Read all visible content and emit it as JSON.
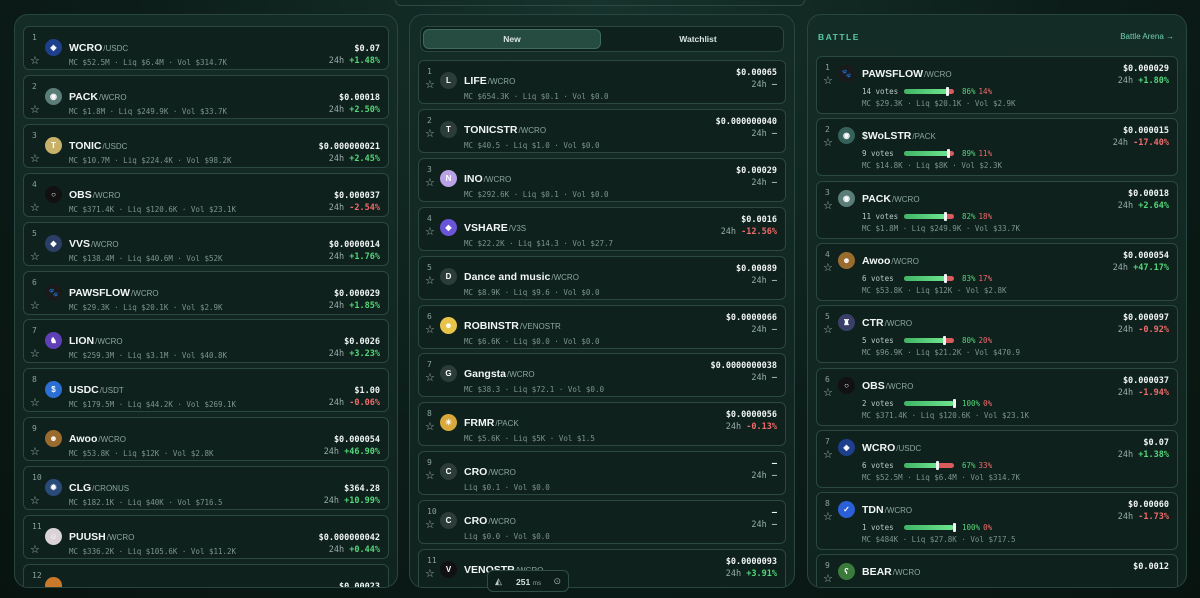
{
  "left": {
    "items": [
      {
        "rank": "1",
        "symbol": "WCRO",
        "pair": "/USDC",
        "price": "$0.07",
        "change": "+1.48%",
        "trend": "pos",
        "mc": "$52.5M",
        "liq": "$6.4M",
        "vol": "$314.7K",
        "logo_color": "#1d3f8c",
        "logo_text": "◈"
      },
      {
        "rank": "2",
        "symbol": "PACK",
        "pair": "/WCRO",
        "price": "$0.00018",
        "change": "+2.50%",
        "trend": "pos",
        "mc": "$1.8M",
        "liq": "$249.9K",
        "vol": "$33.7K",
        "logo_color": "#5b7d79",
        "logo_text": "◉"
      },
      {
        "rank": "3",
        "symbol": "TONIC",
        "pair": "/USDC",
        "price": "$0.000000021",
        "change": "+2.45%",
        "trend": "pos",
        "mc": "$10.7M",
        "liq": "$224.4K",
        "vol": "$98.2K",
        "logo_color": "#c8b26a",
        "logo_text": "T"
      },
      {
        "rank": "4",
        "symbol": "OBS",
        "pair": "/WCRO",
        "price": "$0.000037",
        "change": "-2.54%",
        "trend": "neg",
        "mc": "$371.4K",
        "liq": "$120.6K",
        "vol": "$23.1K",
        "logo_color": "#111111",
        "logo_text": "○"
      },
      {
        "rank": "5",
        "symbol": "VVS",
        "pair": "/WCRO",
        "price": "$0.0000014",
        "change": "+1.76%",
        "trend": "pos",
        "mc": "$138.4M",
        "liq": "$40.6M",
        "vol": "$52K",
        "logo_color": "#2b3f66",
        "logo_text": "◆"
      },
      {
        "rank": "6",
        "symbol": "PAWSFLOW",
        "pair": "/WCRO",
        "price": "$0.000029",
        "change": "+1.85%",
        "trend": "pos",
        "mc": "$29.3K",
        "liq": "$20.1K",
        "vol": "$2.9K",
        "logo_color": "#1a1a1a",
        "logo_text": "🐾"
      },
      {
        "rank": "7",
        "symbol": "LION",
        "pair": "/WCRO",
        "price": "$0.0026",
        "change": "+3.23%",
        "trend": "pos",
        "mc": "$259.3M",
        "liq": "$3.1M",
        "vol": "$40.8K",
        "logo_color": "#5f3fb8",
        "logo_text": "♞"
      },
      {
        "rank": "8",
        "symbol": "USDC",
        "pair": "/USDT",
        "price": "$1.00",
        "change": "-0.06%",
        "trend": "neg",
        "mc": "$179.5M",
        "liq": "$44.2K",
        "vol": "$269.1K",
        "logo_color": "#2a6fd1",
        "logo_text": "$"
      },
      {
        "rank": "9",
        "symbol": "Awoo",
        "pair": "/WCRO",
        "price": "$0.000054",
        "change": "+46.90%",
        "trend": "pos",
        "mc": "$53.8K",
        "liq": "$12K",
        "vol": "$2.8K",
        "logo_color": "#9a6b2e",
        "logo_text": "☻"
      },
      {
        "rank": "10",
        "symbol": "CLG",
        "pair": "/CRONUS",
        "price": "$364.28",
        "change": "+10.99%",
        "trend": "pos",
        "mc": "$182.1K",
        "liq": "$40K",
        "vol": "$716.5",
        "logo_color": "#2a4a7a",
        "logo_text": "✹"
      },
      {
        "rank": "11",
        "symbol": "PUUSH",
        "pair": "/WCRO",
        "price": "$0.000000042",
        "change": "+0.44%",
        "trend": "pos",
        "mc": "$336.2K",
        "liq": "$105.6K",
        "vol": "$11.2K",
        "logo_color": "#d9d2d6",
        "logo_text": "☺"
      },
      {
        "rank": "12",
        "symbol": "",
        "pair": "",
        "price": "$0.00023",
        "change": "",
        "trend": "pos",
        "mc": "",
        "liq": "",
        "vol": "",
        "logo_color": "#c87a2a",
        "logo_text": ""
      }
    ]
  },
  "mid": {
    "tabs": [
      "New",
      "Watchlist"
    ],
    "items": [
      {
        "rank": "1",
        "symbol": "LIFE",
        "pair": "/WCRO",
        "price": "$0.00065",
        "change": "–",
        "trend": "flat",
        "line": "MC $654.3K · Liq $0.1 · Vol $0.0",
        "logo_color": "#2c3d39",
        "logo_text": "L"
      },
      {
        "rank": "2",
        "symbol": "TONICSTR",
        "pair": "/WCRO",
        "price": "$0.000000040",
        "change": "–",
        "trend": "flat",
        "line": "MC $40.5 · Liq $1.0 · Vol $0.0",
        "logo_color": "#2c3d39",
        "logo_text": "T"
      },
      {
        "rank": "3",
        "symbol": "INO",
        "pair": "/WCRO",
        "price": "$0.00029",
        "change": "–",
        "trend": "flat",
        "line": "MC $292.6K · Liq $0.1 · Vol $0.0",
        "logo_color": "#b9a3e6",
        "logo_text": "N"
      },
      {
        "rank": "4",
        "symbol": "VSHARE",
        "pair": "/V3S",
        "price": "$0.0016",
        "change": "-12.56%",
        "trend": "neg",
        "line": "MC $22.2K · Liq $14.3 · Vol $27.7",
        "logo_color": "#6a55d8",
        "logo_text": "◆"
      },
      {
        "rank": "5",
        "symbol": "Dance and music",
        "pair": "/WCRO",
        "price": "$0.00089",
        "change": "–",
        "trend": "flat",
        "line": "MC $8.9K · Liq $9.6 · Vol $0.0",
        "logo_color": "#2c3d39",
        "logo_text": "D"
      },
      {
        "rank": "6",
        "symbol": "ROBINSTR",
        "pair": "/VENOSTR",
        "price": "$0.0000066",
        "change": "–",
        "trend": "flat",
        "line": "MC $6.6K · Liq $0.0 · Vol $0.0",
        "logo_color": "#e8c34a",
        "logo_text": "☻"
      },
      {
        "rank": "7",
        "symbol": "Gangsta",
        "pair": "/WCRO",
        "price": "$0.0000000038",
        "change": "–",
        "trend": "flat",
        "line": "MC $38.3 · Liq $72.1 · Vol $0.0",
        "logo_color": "#2c3d39",
        "logo_text": "G"
      },
      {
        "rank": "8",
        "symbol": "FRMR",
        "pair": "/PACK",
        "price": "$0.0000056",
        "change": "-0.13%",
        "trend": "neg",
        "line": "MC $5.6K · Liq $5K · Vol $1.5",
        "logo_color": "#d9a83a",
        "logo_text": "☀"
      },
      {
        "rank": "9",
        "symbol": "CRO",
        "pair": "/WCRO",
        "price": "–",
        "change": "–",
        "trend": "flat",
        "line": "Liq $0.1 · Vol $0.0",
        "logo_color": "#2c3d39",
        "logo_text": "C"
      },
      {
        "rank": "10",
        "symbol": "CRO",
        "pair": "/WCRO",
        "price": "–",
        "change": "–",
        "trend": "flat",
        "line": "Liq $0.0 · Vol $0.0",
        "logo_color": "#2c3d39",
        "logo_text": "C"
      },
      {
        "rank": "11",
        "symbol": "VENOSTR",
        "pair": "/WCRO",
        "price": "$0.0000093",
        "change": "+3.91%",
        "trend": "pos",
        "line": "",
        "logo_color": "#111111",
        "logo_text": "V"
      }
    ]
  },
  "right": {
    "title": "BATTLE",
    "link": "Battle Arena →",
    "items": [
      {
        "rank": "1",
        "symbol": "PAWSFLOW",
        "pair": "/WCRO",
        "price": "$0.000029",
        "change": "+1.80%",
        "trend": "pos",
        "votes": "14 votes",
        "yes": 86,
        "yes_label": "86%",
        "no_label": "14%",
        "mc": "$29.3K",
        "liq": "$20.1K",
        "vol": "$2.9K",
        "logo_color": "#1a1a1a",
        "logo_text": "🐾"
      },
      {
        "rank": "2",
        "symbol": "$WoLSTR",
        "pair": "/PACK",
        "price": "$0.000015",
        "change": "-17.40%",
        "trend": "neg",
        "votes": "9 votes",
        "yes": 89,
        "yes_label": "89%",
        "no_label": "11%",
        "mc": "$14.8K",
        "liq": "$8K",
        "vol": "$2.3K",
        "logo_color": "#36605a",
        "logo_text": "◉"
      },
      {
        "rank": "3",
        "symbol": "PACK",
        "pair": "/WCRO",
        "price": "$0.00018",
        "change": "+2.64%",
        "trend": "pos",
        "votes": "11 votes",
        "yes": 82,
        "yes_label": "82%",
        "no_label": "18%",
        "mc": "$1.8M",
        "liq": "$249.9K",
        "vol": "$33.7K",
        "logo_color": "#5b7d79",
        "logo_text": "◉"
      },
      {
        "rank": "4",
        "symbol": "Awoo",
        "pair": "/WCRO",
        "price": "$0.000054",
        "change": "+47.17%",
        "trend": "pos",
        "votes": "6 votes",
        "yes": 83,
        "yes_label": "83%",
        "no_label": "17%",
        "mc": "$53.8K",
        "liq": "$12K",
        "vol": "$2.8K",
        "logo_color": "#9a6b2e",
        "logo_text": "☻"
      },
      {
        "rank": "5",
        "symbol": "CTR",
        "pair": "/WCRO",
        "price": "$0.000097",
        "change": "-0.92%",
        "trend": "neg",
        "votes": "5 votes",
        "yes": 80,
        "yes_label": "80%",
        "no_label": "20%",
        "mc": "$96.9K",
        "liq": "$21.2K",
        "vol": "$470.9",
        "logo_color": "#3a3f6a",
        "logo_text": "♜"
      },
      {
        "rank": "6",
        "symbol": "OBS",
        "pair": "/WCRO",
        "price": "$0.000037",
        "change": "-1.94%",
        "trend": "neg",
        "votes": "2 votes",
        "yes": 100,
        "yes_label": "100%",
        "no_label": "0%",
        "mc": "$371.4K",
        "liq": "$120.6K",
        "vol": "$23.1K",
        "logo_color": "#111111",
        "logo_text": "○"
      },
      {
        "rank": "7",
        "symbol": "WCRO",
        "pair": "/USDC",
        "price": "$0.07",
        "change": "+1.38%",
        "trend": "pos",
        "votes": "6 votes",
        "yes": 67,
        "yes_label": "67%",
        "no_label": "33%",
        "mc": "$52.5M",
        "liq": "$6.4M",
        "vol": "$314.7K",
        "logo_color": "#1d3f8c",
        "logo_text": "◈"
      },
      {
        "rank": "8",
        "symbol": "TDN",
        "pair": "/WCRO",
        "price": "$0.00060",
        "change": "-1.73%",
        "trend": "neg",
        "votes": "1 votes",
        "yes": 100,
        "yes_label": "100%",
        "no_label": "0%",
        "mc": "$484K",
        "liq": "$27.8K",
        "vol": "$717.5",
        "logo_color": "#2a5fd8",
        "logo_text": "✓"
      },
      {
        "rank": "9",
        "symbol": "BEAR",
        "pair": "/WCRO",
        "price": "$0.0012",
        "change": "",
        "trend": "pos",
        "votes": "",
        "yes": 0,
        "yes_label": "",
        "no_label": "",
        "mc": "",
        "liq": "",
        "vol": "",
        "logo_color": "#3a7a3a",
        "logo_text": "ʕ"
      }
    ]
  },
  "footer": {
    "ping_value": "251",
    "ping_unit": "ms"
  }
}
